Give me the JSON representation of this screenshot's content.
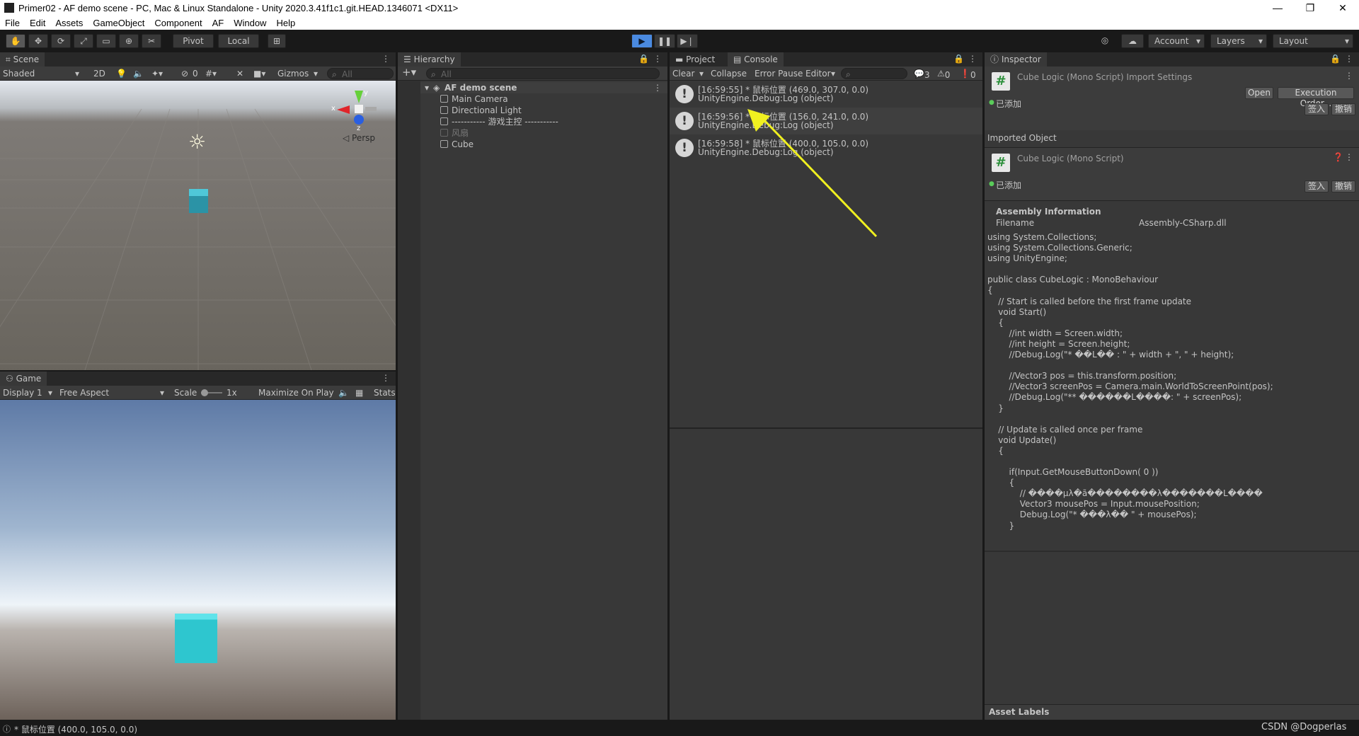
{
  "window": {
    "title": "Primer02 - AF demo scene - PC, Mac & Linux Standalone - Unity 2020.3.41f1c1.git.HEAD.1346071 <DX11>",
    "minimize": "—",
    "restore": "❐",
    "close": "✕"
  },
  "menu": [
    "File",
    "Edit",
    "Assets",
    "GameObject",
    "Component",
    "AF",
    "Window",
    "Help"
  ],
  "toolbar": {
    "pivot": "Pivot",
    "local": "Local",
    "account": "Account",
    "layers": "Layers",
    "layout": "Layout"
  },
  "scene": {
    "tab": "Scene",
    "shading": "Shaded",
    "mode2d": "2D",
    "fx_count": "0",
    "gizmos": "Gizmos",
    "search_placeholder": "All",
    "persp": "Persp",
    "axis_x": "x",
    "axis_y": "y",
    "axis_z": "z"
  },
  "game": {
    "tab": "Game",
    "display": "Display 1",
    "aspect": "Free Aspect",
    "scale_label": "Scale",
    "scale_value": "1x",
    "maximize": "Maximize On Play",
    "stats": "Stats"
  },
  "hierarchy": {
    "tab": "Hierarchy",
    "search_placeholder": "All",
    "scene_name": "AF demo scene",
    "items": [
      {
        "label": "Main Camera",
        "dim": false
      },
      {
        "label": "Directional Light",
        "dim": false
      },
      {
        "label": "----------- 游戏主控 -----------",
        "dim": false
      },
      {
        "label": "风扇",
        "dim": true
      },
      {
        "label": "Cube",
        "dim": false
      }
    ]
  },
  "console": {
    "tab_project": "Project",
    "tab_console": "Console",
    "clear": "Clear",
    "collapse": "Collapse",
    "error_pause": "Error Pause",
    "editor": "Editor",
    "count_log": "3",
    "count_warn": "0",
    "count_error": "0",
    "entries": [
      {
        "line1": "[16:59:55] * 鼠标位置 (469.0, 307.0, 0.0)",
        "line2": "UnityEngine.Debug:Log (object)"
      },
      {
        "line1": "[16:59:56] * 鼠标位置 (156.0, 241.0, 0.0)",
        "line2": "UnityEngine.Debug:Log (object)"
      },
      {
        "line1": "[16:59:58] * 鼠标位置 (400.0, 105.0, 0.0)",
        "line2": "UnityEngine.Debug:Log (object)"
      }
    ]
  },
  "inspector": {
    "tab": "Inspector",
    "import_title": "Cube Logic (Mono Script) Import Settings",
    "open": "Open",
    "exec_order": "Execution Order...",
    "added": "已添加",
    "checkin": "签入",
    "revert": "撤销",
    "imported_object": "Imported Object",
    "object_title": "Cube Logic (Mono Script)",
    "assembly_info": "Assembly Information",
    "filename_label": "Filename",
    "filename_value": "Assembly-CSharp.dll",
    "code": "using System.Collections;\nusing System.Collections.Generic;\nusing UnityEngine;\n\npublic class CubeLogic : MonoBehaviour\n{\n    // Start is called before the first frame update\n    void Start()\n    {\n        //int width = Screen.width;\n        //int height = Screen.height;\n        //Debug.Log(\"* ��L�� : \" + width + \", \" + height);\n\n        //Vector3 pos = this.transform.position;\n        //Vector3 screenPos = Camera.main.WorldToScreenPoint(pos);\n        //Debug.Log(\"** ������L����: \" + screenPos);\n    }\n\n    // Update is called once per frame\n    void Update()\n    {\n\n        if(Input.GetMouseButtonDown( 0 ))\n        {\n            // ����µλ�ã��������λ�������L����\n            Vector3 mousePos = Input.mousePosition;\n            Debug.Log(\"* ���λ�� \" + mousePos);\n        }\n\n\n    }\n}",
    "asset_labels": "Asset Labels"
  },
  "status": {
    "message": "* 鼠标位置 (400.0, 105.0, 0.0)",
    "watermark": "CSDN @Dogperlas"
  }
}
